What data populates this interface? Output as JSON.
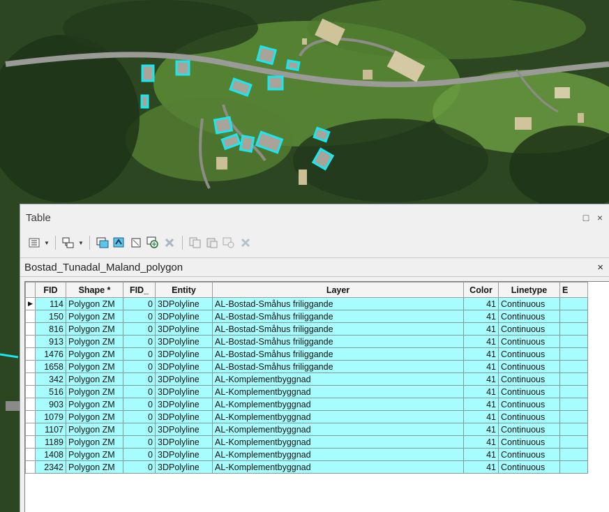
{
  "window": {
    "title": "Table",
    "restore_label": "□",
    "close_label": "×"
  },
  "toolbar": {
    "icons": [
      "table-options-icon",
      "related-tables-icon",
      "select-by-attributes-icon",
      "switch-selection-icon",
      "clear-selection-icon",
      "zoom-to-selected-icon",
      "delete-selected-icon",
      "copy-selected-icon",
      "paste-icon",
      "add-field-icon",
      "delete-icon"
    ]
  },
  "tab": {
    "name": "Bostad_Tunadal_Maland_polygon",
    "close_label": "×"
  },
  "table": {
    "columns": [
      "FID",
      "Shape *",
      "FID_",
      "Entity",
      "Layer",
      "Color",
      "Linetype",
      "E"
    ],
    "rows": [
      [
        "114",
        "Polygon ZM",
        "0",
        "3DPolyline",
        "AL-Bostad-Småhus friliggande",
        "41",
        "Continuous"
      ],
      [
        "150",
        "Polygon ZM",
        "0",
        "3DPolyline",
        "AL-Bostad-Småhus friliggande",
        "41",
        "Continuous"
      ],
      [
        "816",
        "Polygon ZM",
        "0",
        "3DPolyline",
        "AL-Bostad-Småhus friliggande",
        "41",
        "Continuous"
      ],
      [
        "913",
        "Polygon ZM",
        "0",
        "3DPolyline",
        "AL-Bostad-Småhus friliggande",
        "41",
        "Continuous"
      ],
      [
        "1476",
        "Polygon ZM",
        "0",
        "3DPolyline",
        "AL-Bostad-Småhus friliggande",
        "41",
        "Continuous"
      ],
      [
        "1658",
        "Polygon ZM",
        "0",
        "3DPolyline",
        "AL-Bostad-Småhus friliggande",
        "41",
        "Continuous"
      ],
      [
        "342",
        "Polygon ZM",
        "0",
        "3DPolyline",
        "AL-Komplementbyggnad",
        "41",
        "Continuous"
      ],
      [
        "516",
        "Polygon ZM",
        "0",
        "3DPolyline",
        "AL-Komplementbyggnad",
        "41",
        "Continuous"
      ],
      [
        "903",
        "Polygon ZM",
        "0",
        "3DPolyline",
        "AL-Komplementbyggnad",
        "41",
        "Continuous"
      ],
      [
        "1079",
        "Polygon ZM",
        "0",
        "3DPolyline",
        "AL-Komplementbyggnad",
        "41",
        "Continuous"
      ],
      [
        "1107",
        "Polygon ZM",
        "0",
        "3DPolyline",
        "AL-Komplementbyggnad",
        "41",
        "Continuous"
      ],
      [
        "1189",
        "Polygon ZM",
        "0",
        "3DPolyline",
        "AL-Komplementbyggnad",
        "41",
        "Continuous"
      ],
      [
        "1408",
        "Polygon ZM",
        "0",
        "3DPolyline",
        "AL-Komplementbyggnad",
        "41",
        "Continuous"
      ],
      [
        "2342",
        "Polygon ZM",
        "0",
        "3DPolyline",
        "AL-Komplementbyggnad",
        "41",
        "Continuous"
      ]
    ],
    "current_row_marker": "▶"
  },
  "colors": {
    "selected_row": "#a7fdfd",
    "highlight_outline": "#19e6f0"
  }
}
